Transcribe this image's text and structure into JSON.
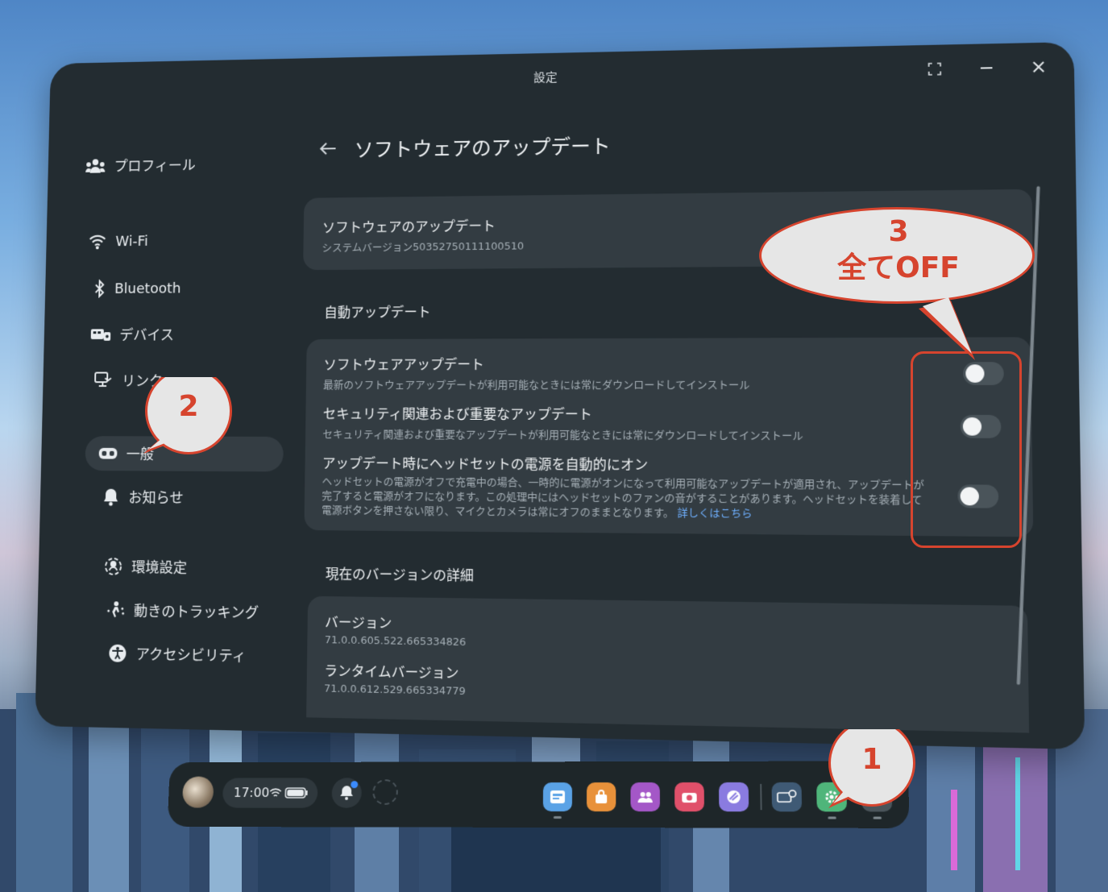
{
  "window": {
    "title": "設定"
  },
  "sidebar": {
    "items": [
      {
        "label": "プロフィール",
        "icon": "people-icon"
      },
      {
        "label": "Wi-Fi",
        "icon": "wifi-icon"
      },
      {
        "label": "Bluetooth",
        "icon": "bluetooth-icon"
      },
      {
        "label": "デバイス",
        "icon": "device-icon"
      },
      {
        "label": "リンク",
        "icon": "link-icon"
      },
      {
        "label": "一般",
        "icon": "headset-icon",
        "selected": true
      },
      {
        "label": "お知らせ",
        "icon": "bell-icon"
      },
      {
        "label": "環境設定",
        "icon": "environment-icon"
      },
      {
        "label": "動きのトラッキング",
        "icon": "tracking-icon"
      },
      {
        "label": "アクセシビリティ",
        "icon": "accessibility-icon"
      }
    ]
  },
  "page": {
    "title": "ソフトウェアのアップデート",
    "info_card": {
      "title": "ソフトウェアのアップデート",
      "subtitle": "システムバージョン50352750111100510"
    },
    "auto_section": {
      "heading": "自動アップデート",
      "rows": [
        {
          "title": "ソフトウェアアップデート",
          "desc": "最新のソフトウェアアップデートが利用可能なときには常にダウンロードしてインストール",
          "enabled": false
        },
        {
          "title": "セキュリティ関連および重要なアップデート",
          "desc": "セキュリティ関連および重要なアップデートが利用可能なときには常にダウンロードしてインストール",
          "enabled": false
        },
        {
          "title": "アップデート時にヘッドセットの電源を自動的にオン",
          "desc_lines": [
            "ヘッドセットの電源がオフで充電中の場合、一時的に電源がオンになって利用可能なアップデートが適用され、アップデートが",
            "完了すると電源がオフになります。この処理中にはヘッドセットのファンの音がすることがあります。ヘッドセットを装着して",
            "電源ボタンを押さない限り、マイクとカメラは常にオフのままとなります。"
          ],
          "link": "詳しくはこちら",
          "enabled": false
        }
      ]
    },
    "version_section": {
      "heading": "現在のバージョンの詳細",
      "items": [
        {
          "label": "バージョン",
          "value": "71.0.0.605.522.665334826"
        },
        {
          "label": "ランタイムバージョン",
          "value": "71.0.0.612.529.665334779"
        }
      ]
    }
  },
  "annotations": {
    "callout_1": "1",
    "callout_2": "2",
    "callout_3_number": "3",
    "callout_3_text": "全てOFF",
    "color": "#d6442e"
  },
  "taskbar": {
    "time": "17:00",
    "apps": [
      {
        "icon": "browser-icon",
        "color": "#5aa2e6"
      },
      {
        "icon": "store-icon",
        "color": "#e8913a"
      },
      {
        "icon": "people-app-icon",
        "color": "#a457c7"
      },
      {
        "icon": "camera-icon",
        "color": "#e0506a"
      },
      {
        "icon": "horizon-icon",
        "color": "#8a7be0"
      },
      {
        "icon": "device-app-icon",
        "color": "#3f5a75"
      },
      {
        "icon": "settings-icon",
        "color": "#4fb57a"
      },
      {
        "icon": "app-grid-icon",
        "color": "#4a545a"
      }
    ]
  }
}
